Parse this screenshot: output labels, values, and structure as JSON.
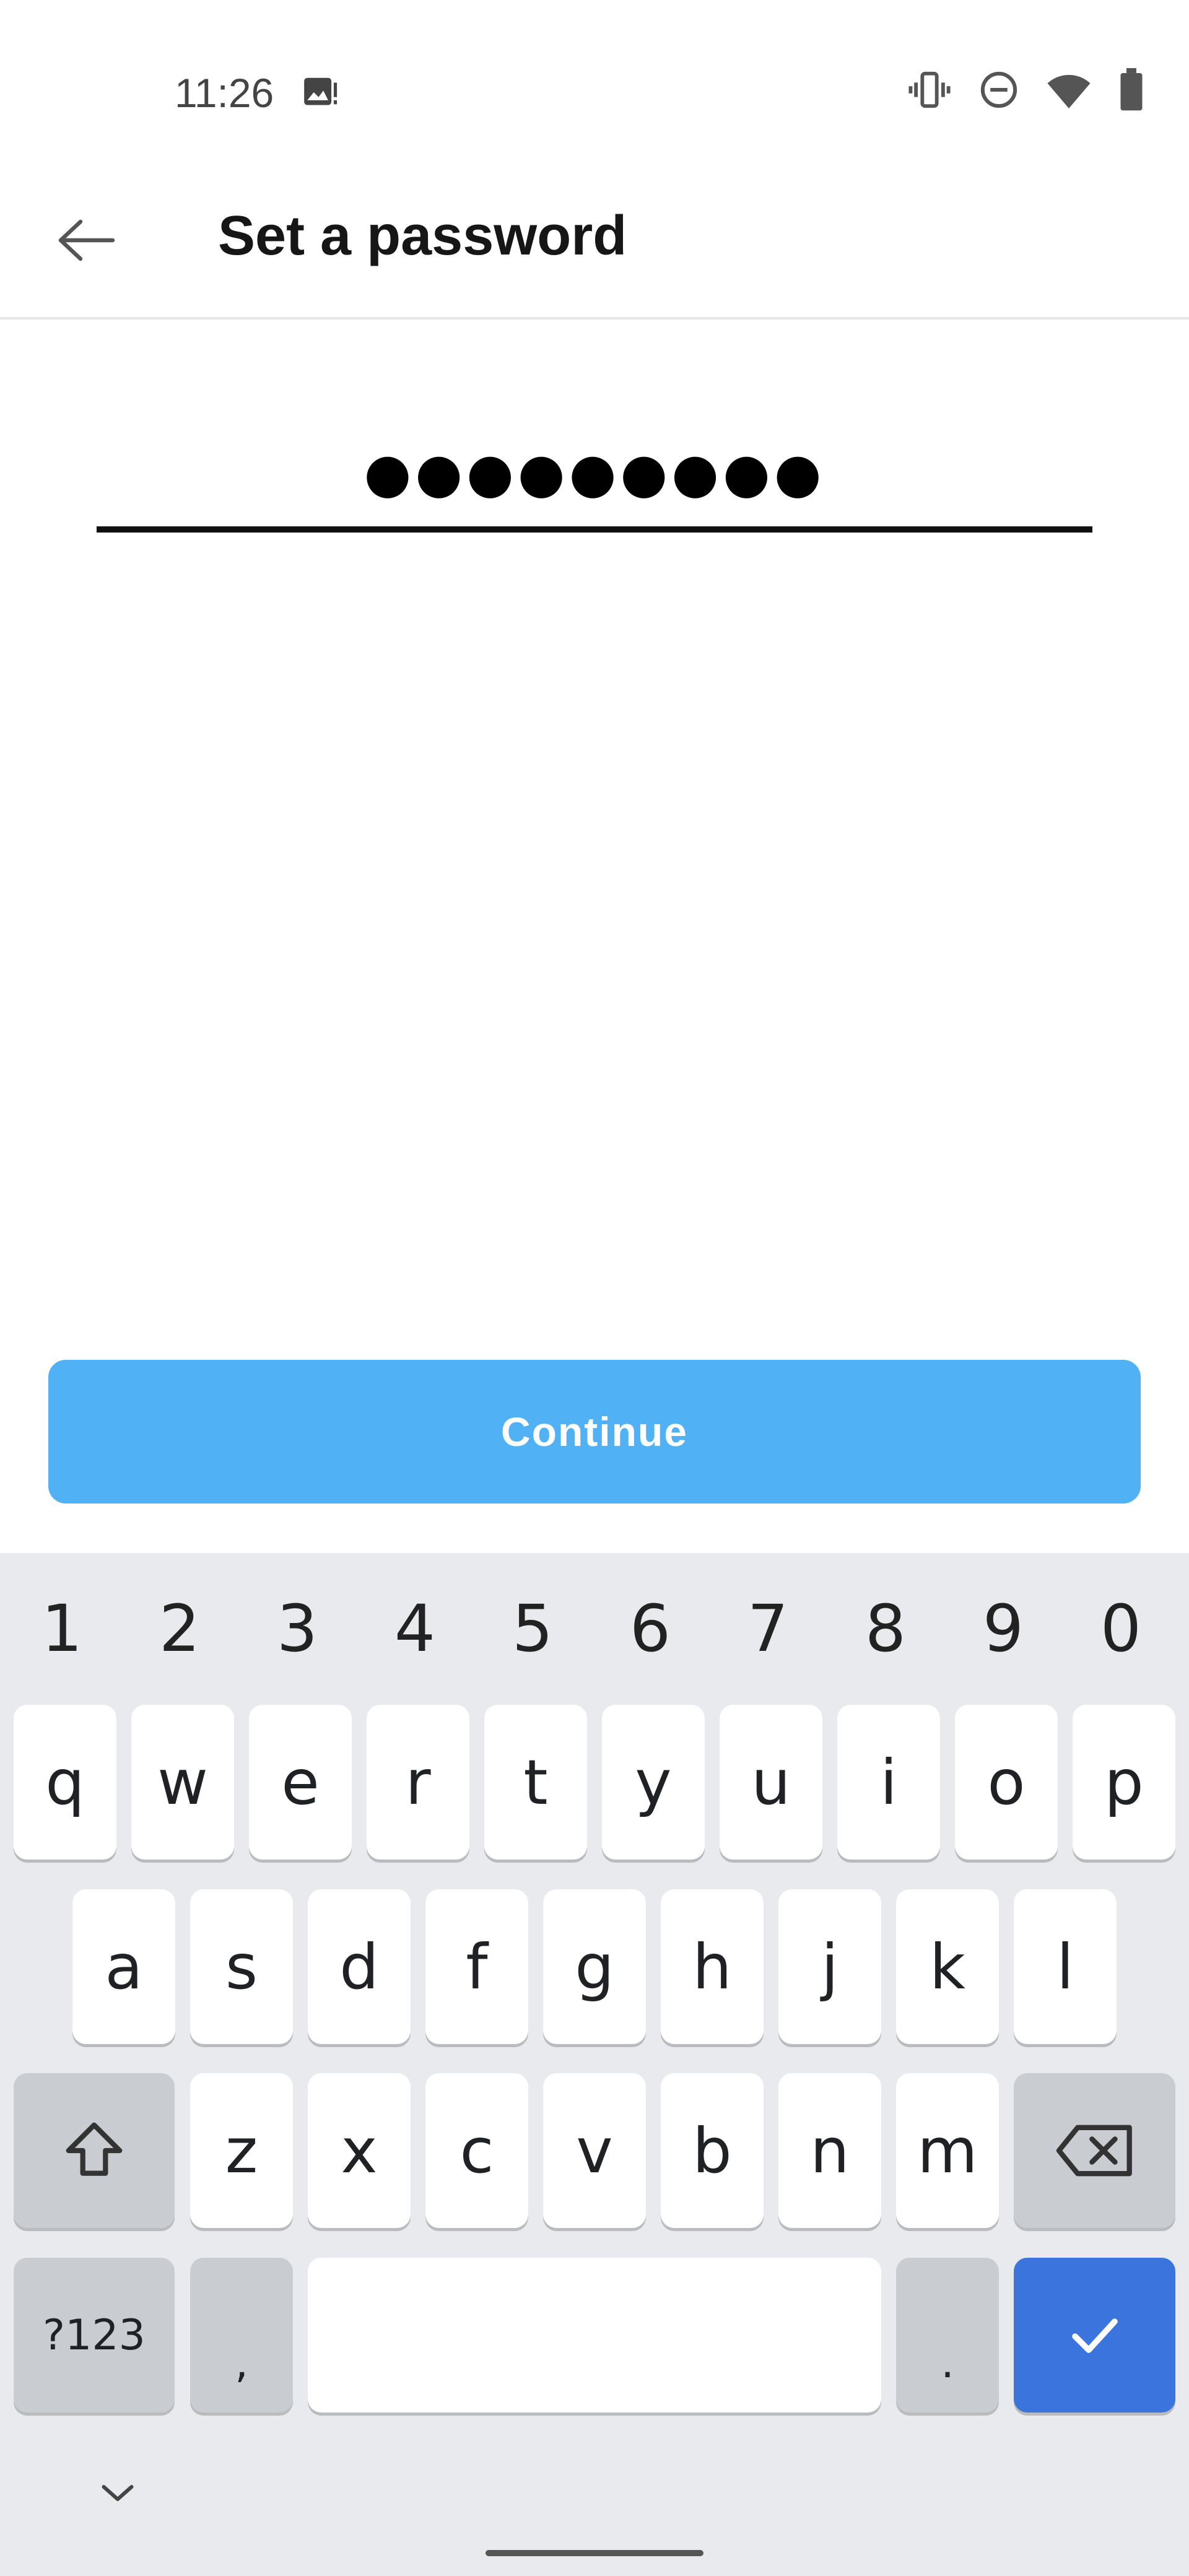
{
  "status_bar": {
    "time": "11:26",
    "icons": [
      "photo-icon",
      "vibrate-icon",
      "do-not-disturb-icon",
      "wifi-icon",
      "battery-icon"
    ]
  },
  "app_bar": {
    "title": "Set a password",
    "back_icon": "arrow-left-icon"
  },
  "password_field": {
    "masked_value": "●●●●●●●●●",
    "length": 9
  },
  "continue_button": {
    "label": "Continue",
    "color": "#50b1f4"
  },
  "keyboard": {
    "number_row": [
      "1",
      "2",
      "3",
      "4",
      "5",
      "6",
      "7",
      "8",
      "9",
      "0"
    ],
    "row1": [
      "q",
      "w",
      "e",
      "r",
      "t",
      "y",
      "u",
      "i",
      "o",
      "p"
    ],
    "row2": [
      "a",
      "s",
      "d",
      "f",
      "g",
      "h",
      "j",
      "k",
      "l"
    ],
    "row3": [
      "z",
      "x",
      "c",
      "v",
      "b",
      "n",
      "m"
    ],
    "symbols_key": "?123",
    "comma_key": ",",
    "period_key": ".",
    "enter_color": "#3b74dd"
  }
}
